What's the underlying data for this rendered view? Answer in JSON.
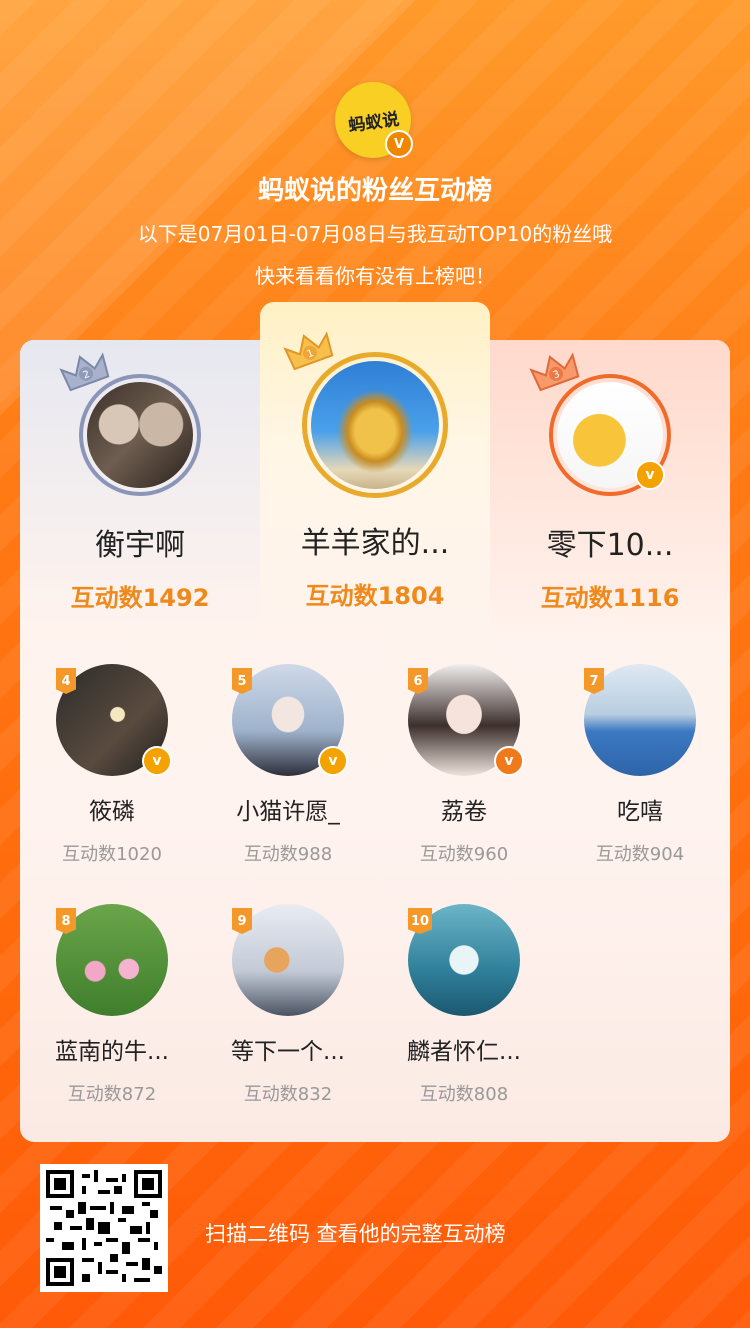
{
  "header": {
    "logo_text": "蚂蚁说",
    "verified_mark": "V",
    "title": "蚂蚁说的粉丝互动榜",
    "subtitle_line1": "以下是07月01日-07月08日与我互动TOP10的粉丝哦",
    "subtitle_line2": "快来看看你有没有上榜吧！"
  },
  "top3": [
    {
      "rank": "2",
      "name": "衡宇啊",
      "count": "互动数1492",
      "verified": false
    },
    {
      "rank": "1",
      "name": "羊羊家的...",
      "count": "互动数1804",
      "verified": false
    },
    {
      "rank": "3",
      "name": "零下10...",
      "count": "互动数1116",
      "verified": true
    }
  ],
  "others": [
    {
      "rank": "4",
      "name": "筱磷",
      "count": "互动数1020",
      "verified": true
    },
    {
      "rank": "5",
      "name": "小猫许愿_",
      "count": "互动数988",
      "verified": true
    },
    {
      "rank": "6",
      "name": "荔卷",
      "count": "互动数960",
      "verified": true
    },
    {
      "rank": "7",
      "name": "吃嘻",
      "count": "互动数904",
      "verified": false
    },
    {
      "rank": "8",
      "name": "蓝南的牛...",
      "count": "互动数872",
      "verified": false
    },
    {
      "rank": "9",
      "name": "等下一个...",
      "count": "互动数832",
      "verified": false
    },
    {
      "rank": "10",
      "name": "麟者怀仁...",
      "count": "互动数808",
      "verified": false
    }
  ],
  "footer": {
    "scan_text": "扫描二维码 查看他的完整互动榜"
  },
  "colors": {
    "brand_orange": "#ff7a14",
    "count_orange": "#f0891c",
    "verified_badge": "#f3a200",
    "silver_ring": "#8a95b8",
    "gold_ring": "#e9a92a",
    "bronze_ring": "#f06a2a"
  }
}
